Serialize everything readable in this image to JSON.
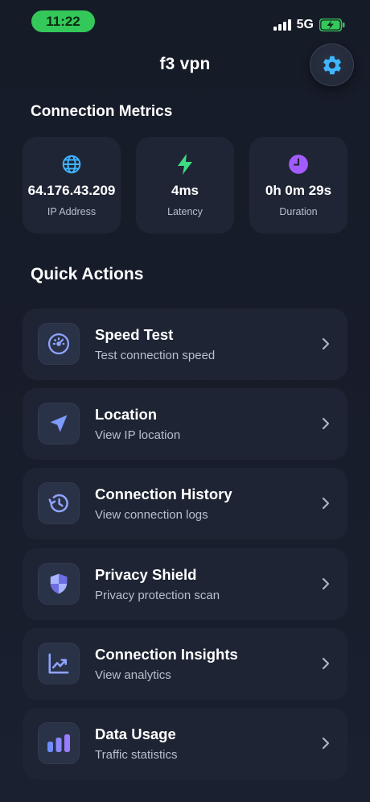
{
  "status_bar": {
    "time": "11:22",
    "network": "5G",
    "battery_color": "#34c759"
  },
  "header": {
    "title": "f3 vpn",
    "settings_icon": "gear-icon",
    "accent": "#3fb6ff"
  },
  "metrics": {
    "section_title": "Connection Metrics",
    "cards": [
      {
        "icon": "globe-icon",
        "icon_color": "#3fb6ff",
        "value": "64.176.43.209",
        "label": "IP Address"
      },
      {
        "icon": "lightning-icon",
        "icon_color": "#3ddc84",
        "value": "4ms",
        "label": "Latency"
      },
      {
        "icon": "clock-icon",
        "icon_color": "#a25bff",
        "value": "0h 0m 29s",
        "label": "Duration"
      }
    ]
  },
  "quick_actions": {
    "section_title": "Quick Actions",
    "items": [
      {
        "icon": "speedometer-icon",
        "title": "Speed Test",
        "subtitle": "Test connection speed"
      },
      {
        "icon": "location-arrow-icon",
        "title": "Location",
        "subtitle": "View IP location"
      },
      {
        "icon": "history-icon",
        "title": "Connection History",
        "subtitle": "View connection logs"
      },
      {
        "icon": "shield-icon",
        "title": "Privacy Shield",
        "subtitle": "Privacy protection scan"
      },
      {
        "icon": "trend-chart-icon",
        "title": "Connection Insights",
        "subtitle": "View analytics"
      },
      {
        "icon": "bar-chart-icon",
        "title": "Data Usage",
        "subtitle": "Traffic statistics"
      }
    ]
  }
}
